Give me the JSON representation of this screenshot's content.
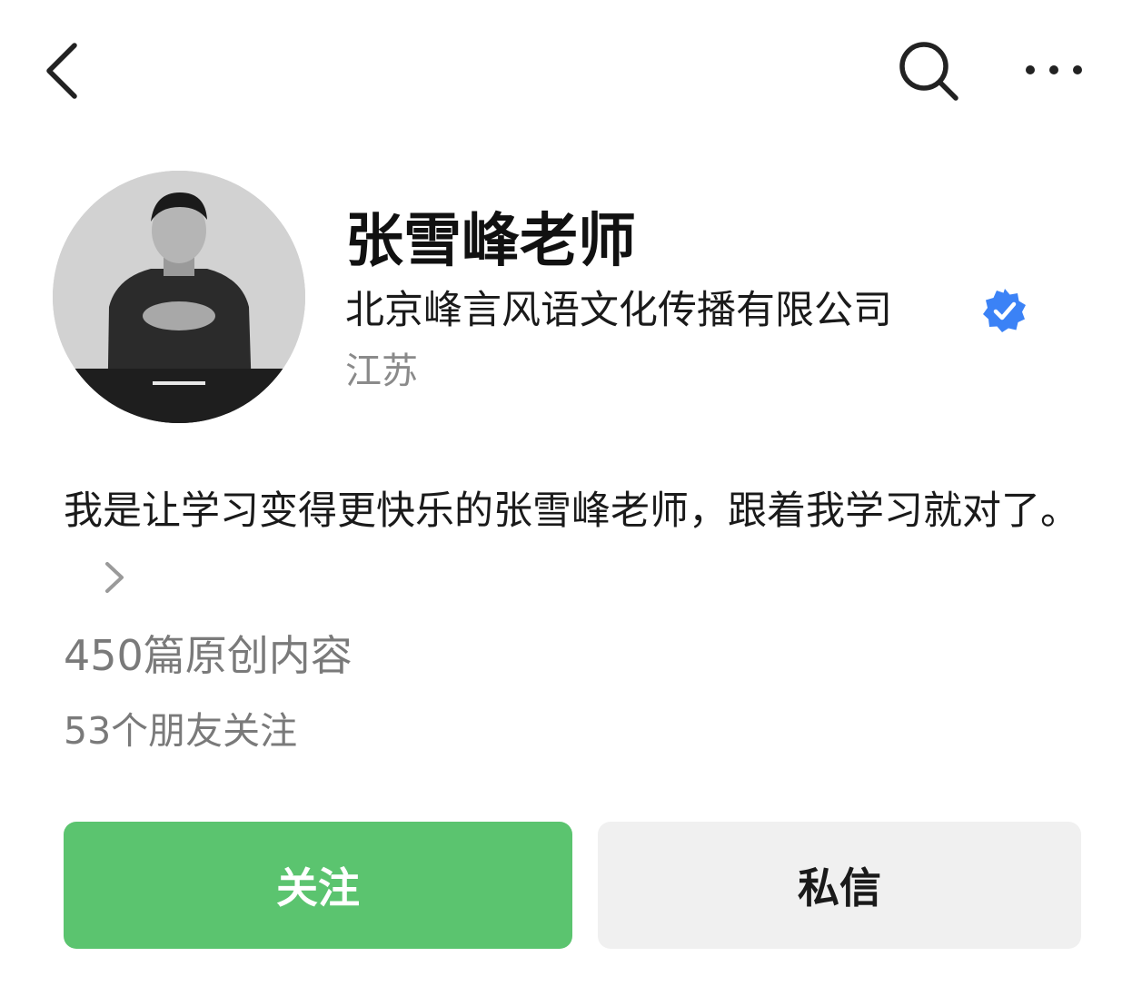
{
  "header": {
    "back_icon": "chevron-left-icon",
    "search_icon": "search-icon",
    "more_icon": "more-horizontal-icon"
  },
  "profile": {
    "name": "张雪峰老师",
    "organization": "北京峰言风语文化传播有限公司",
    "verified_icon": "verified-badge-icon",
    "verified_color": "#3b82f6",
    "region": "江苏",
    "bio": "我是让学习变得更快乐的张雪峰老师，跟着我学习就对了。",
    "original_count_text": "450篇原创内容",
    "friends_following_text": "53个朋友关注"
  },
  "actions": {
    "follow_label": "关注",
    "follow_color": "#5bc46f",
    "message_label": "私信"
  }
}
